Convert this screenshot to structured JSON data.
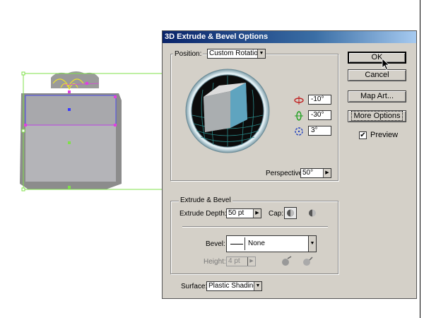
{
  "dialog": {
    "title": "3D Extrude & Bevel Options",
    "position": {
      "label": "Position:",
      "value": "Custom Rotation",
      "rotation_x": "-10°",
      "rotation_y": "-30°",
      "rotation_z": "3°",
      "perspective_label": "Perspective:",
      "perspective_value": "50°"
    },
    "extrude": {
      "group_title": "Extrude & Bevel",
      "depth_label": "Extrude Depth:",
      "depth_value": "50 pt",
      "cap_label": "Cap:",
      "bevel_label": "Bevel:",
      "bevel_value": "None",
      "height_label": "Height:",
      "height_value": "4 pt"
    },
    "surface": {
      "label": "Surface:",
      "value": "Plastic Shading"
    },
    "buttons": {
      "ok": "OK",
      "cancel": "Cancel",
      "map_art": "Map Art...",
      "more_options": "More Options"
    },
    "preview": {
      "label": "Preview",
      "checked": true,
      "check_glyph": "✔"
    }
  },
  "icons": [
    "rotate-x-icon",
    "rotate-y-icon",
    "rotate-z-icon",
    "cap-on-icon",
    "cap-off-icon",
    "bevel-in-icon",
    "bevel-out-icon",
    "mouse-cursor-icon"
  ],
  "colors": {
    "dialog_bg": "#d4d0c8",
    "title_start": "#0a246a",
    "title_end": "#a6caf0",
    "cube_face": "#5fa4bf",
    "selection_green": "#7fe04a",
    "selection_magenta": "#e040e0"
  }
}
